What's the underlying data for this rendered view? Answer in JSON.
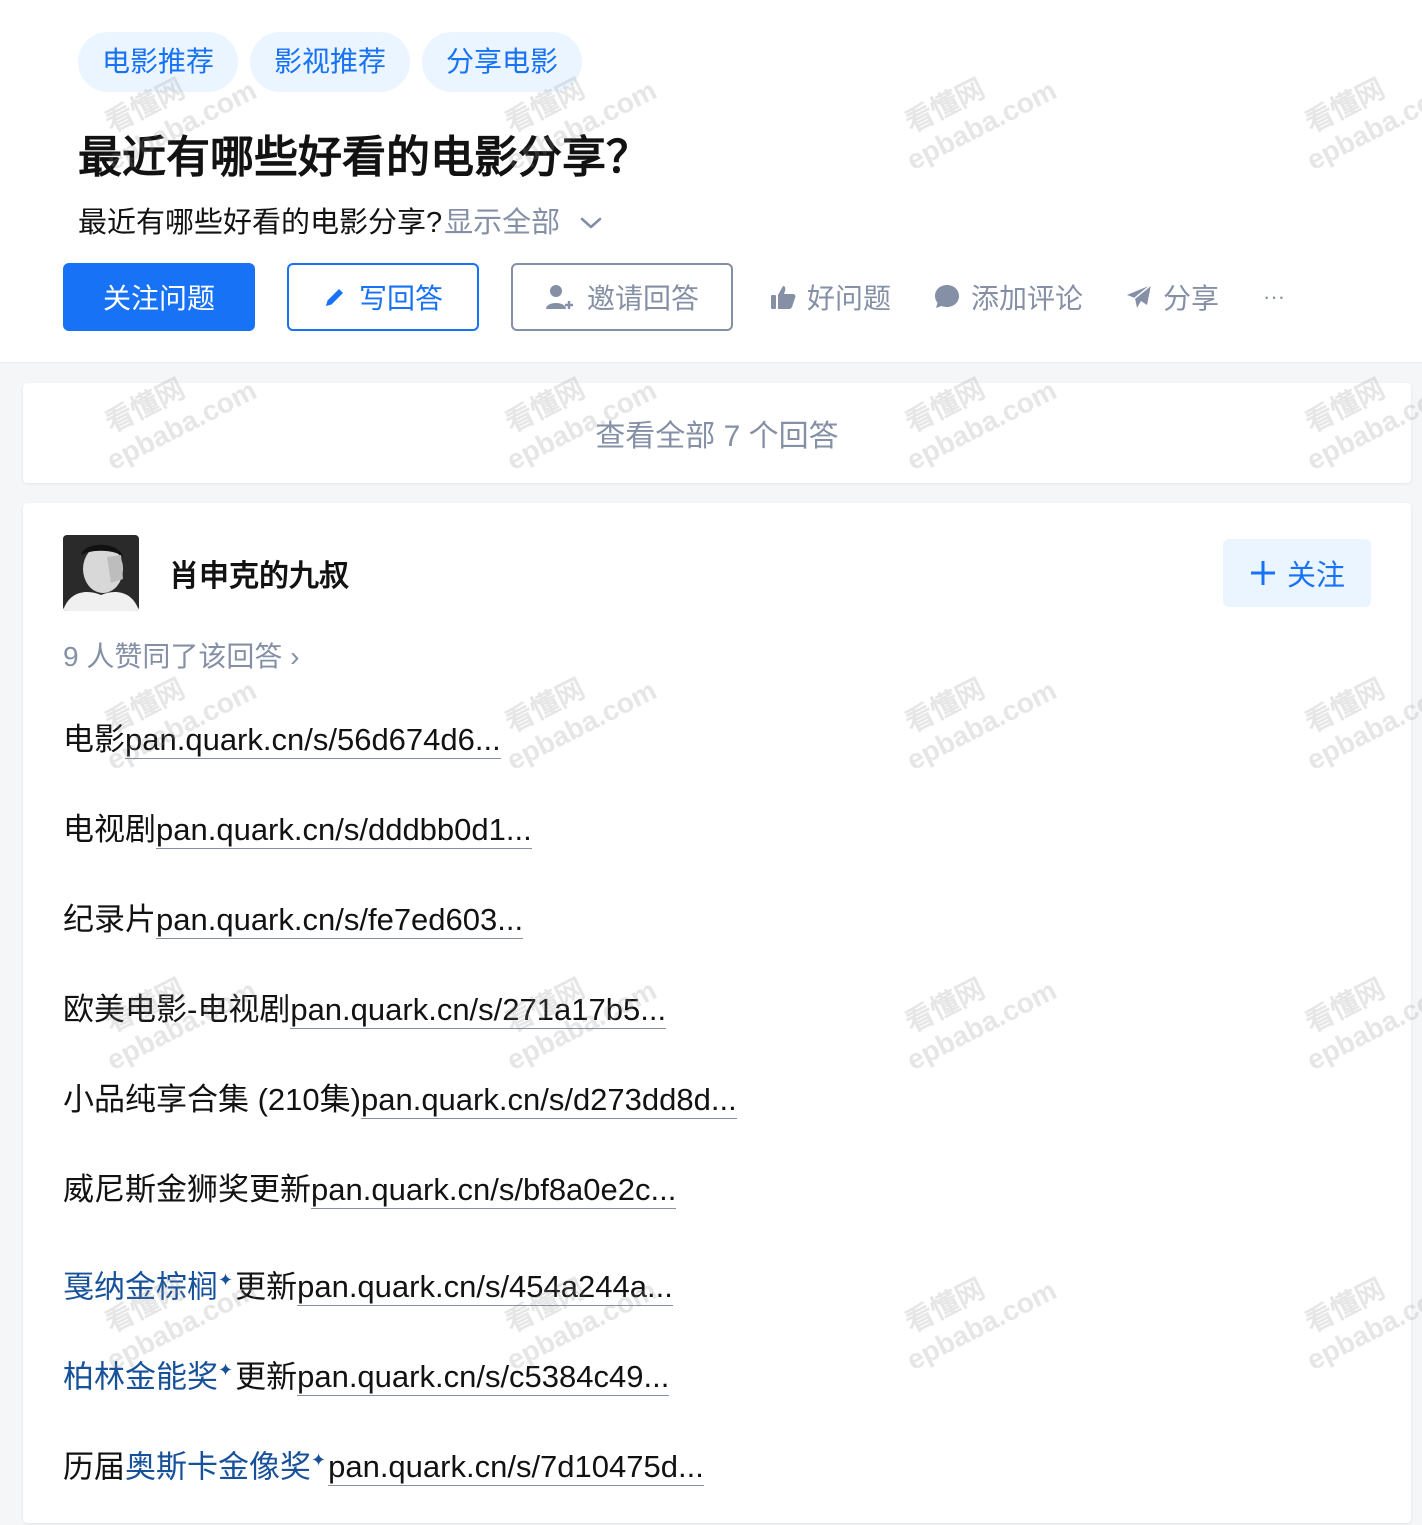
{
  "question": {
    "tags": [
      "电影推荐",
      "影视推荐",
      "分享电影"
    ],
    "title": "最近有哪些好看的电影分享？",
    "detail": "最近有哪些好看的电影分享?",
    "show_all": "显示全部"
  },
  "actions": {
    "follow": "关注问题",
    "write": "写回答",
    "invite": "邀请回答",
    "good_question": "好问题",
    "comment": "添加评论",
    "share": "分享",
    "more": "···"
  },
  "view_all": "查看全部 7 个回答",
  "answer": {
    "author": "肖申克的九叔",
    "follow_btn": "关注",
    "votes": "9 人赞同了该回答 ›",
    "lines": [
      {
        "prefix": "电影",
        "link": "pan.quark.cn/s/56d674d6..."
      },
      {
        "prefix": "电视剧",
        "link": "pan.quark.cn/s/dddbb0d1..."
      },
      {
        "prefix": "纪录片",
        "link": "pan.quark.cn/s/fe7ed603..."
      },
      {
        "prefix": "欧美电影-电视剧",
        "link": "pan.quark.cn/s/271a17b5..."
      },
      {
        "prefix": "小品纯享合集 (210集)",
        "link": "pan.quark.cn/s/d273dd8d..."
      },
      {
        "prefix": "威尼斯金狮奖更新",
        "link": "pan.quark.cn/s/bf8a0e2c..."
      },
      {
        "keyword": "戛纳金棕榈",
        "mid": "更新",
        "link": "pan.quark.cn/s/454a244a..."
      },
      {
        "keyword": "柏林金能奖",
        "mid": "更新",
        "link": "pan.quark.cn/s/c5384c49..."
      },
      {
        "pre": "历届",
        "keyword": "奥斯卡金像奖",
        "link": "pan.quark.cn/s/7d10475d..."
      }
    ]
  },
  "watermark": {
    "line1": "看懂网",
    "line2": "epbaba.com"
  },
  "colors": {
    "brand": "#1772f6",
    "muted": "#8590a6",
    "keyword": "#175199"
  }
}
